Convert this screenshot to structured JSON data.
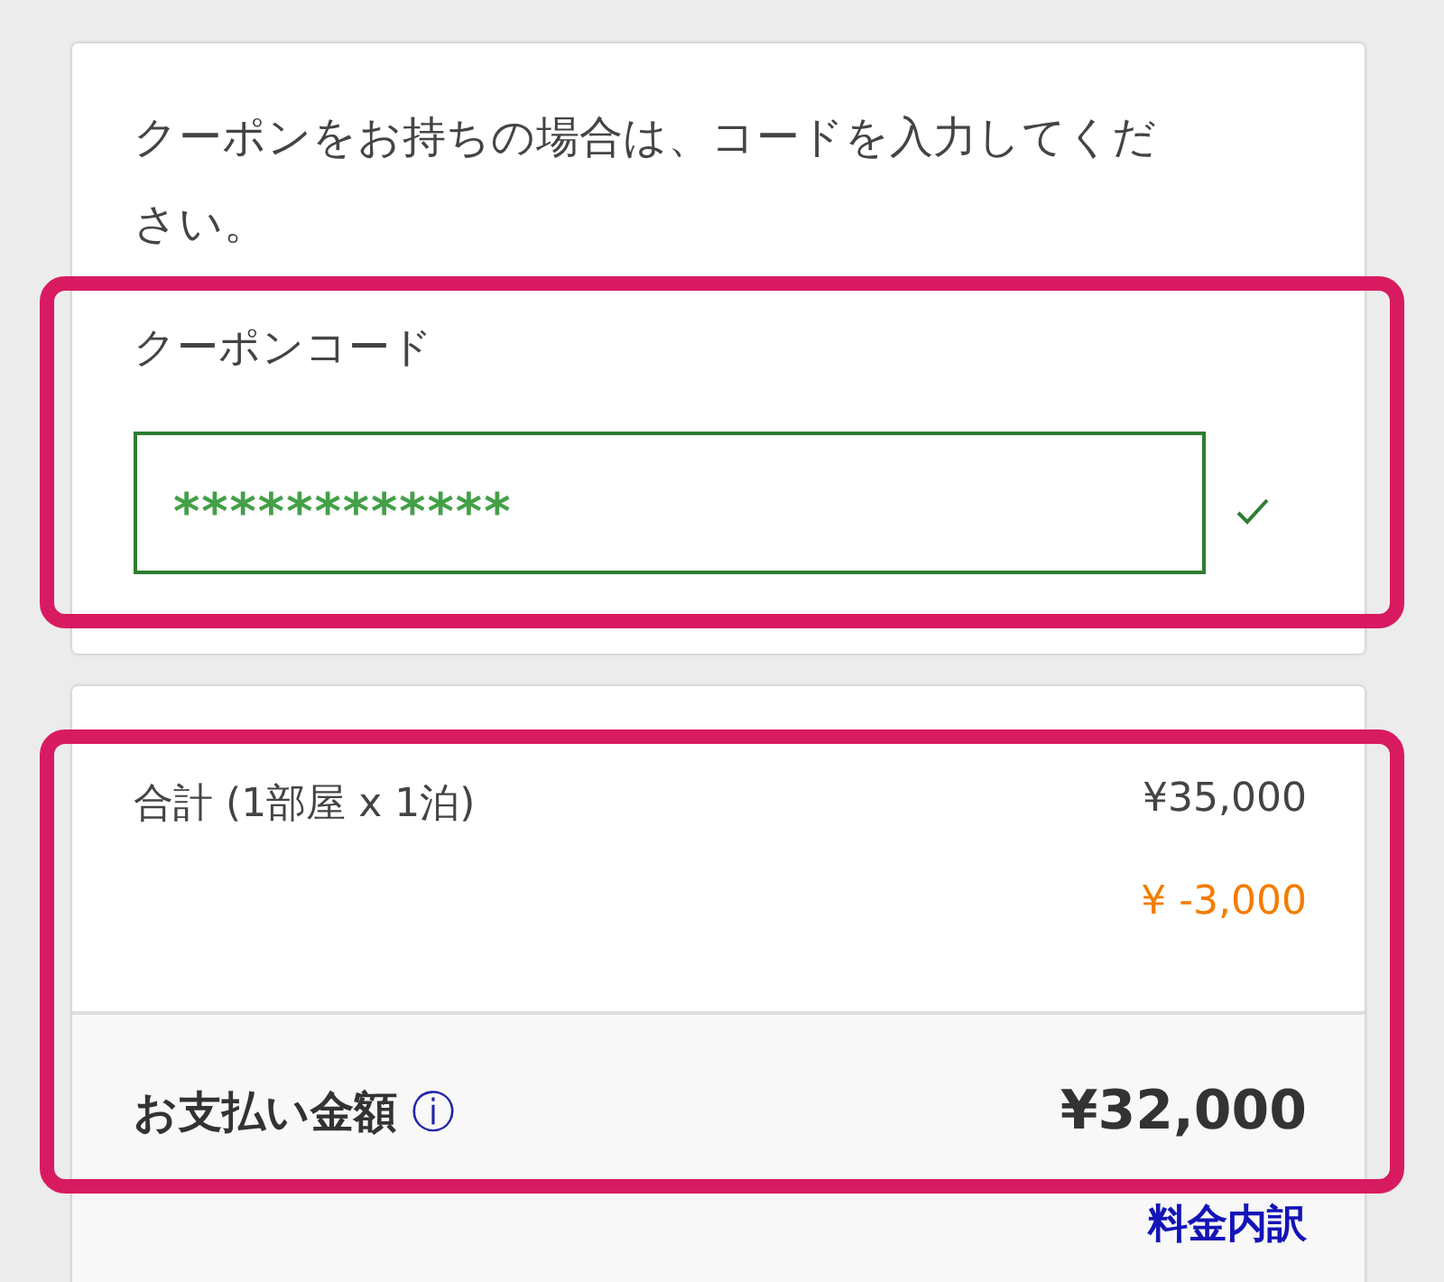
{
  "coupon": {
    "instruction": "クーポンをお持ちの場合は、コードを入力してください。",
    "label": "クーポンコード",
    "value": "************",
    "valid": true
  },
  "summary": {
    "rows": [
      {
        "label": "合計 (1部屋 x 1泊)",
        "amount": "¥35,000",
        "kind": "price"
      },
      {
        "amount": "¥ -3,000",
        "kind": "discount"
      }
    ],
    "total_label": "お支払い金額",
    "info_icon": "ⓘ",
    "total": "¥32,000",
    "breakdown_link": "料金内訳"
  }
}
